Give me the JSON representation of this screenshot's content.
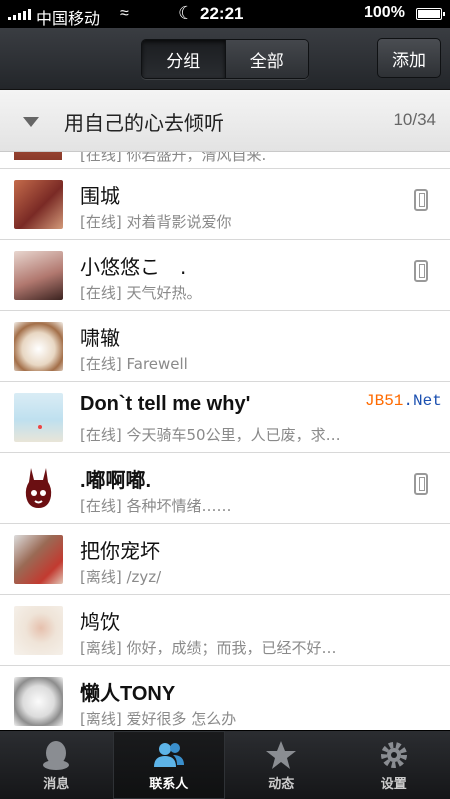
{
  "status_bar": {
    "carrier": "中国移动",
    "time": "22:21",
    "battery": "100%"
  },
  "nav": {
    "segments": [
      "分组",
      "全部"
    ],
    "add_label": "添加"
  },
  "group": {
    "name": "用自己的心去倾听",
    "count": "10/34"
  },
  "partial_row": {
    "sub": "[在线] 你若盛开，清风自来."
  },
  "contacts": [
    {
      "name": "围城",
      "status": "[在线]",
      "message": "对着背影说爱你",
      "phone": true
    },
    {
      "name": "小悠悠こ　.",
      "status": "[在线]",
      "message": "天气好热。",
      "phone": true
    },
    {
      "name": "啸辙",
      "status": "[在线]",
      "message": "Farewell",
      "phone": false
    },
    {
      "name": "Don`t tell me why'",
      "status": "[在线]",
      "message": "今天骑车50公里，人已废，求…",
      "phone": false
    },
    {
      "name": ".嘟啊嘟.",
      "status": "[在线]",
      "message": "各种坏情绪……",
      "phone": true
    },
    {
      "name": "把你宠坏",
      "status": "[离线]",
      "message": "/zyz/",
      "phone": false
    },
    {
      "name": "鸠饮",
      "status": "[离线]",
      "message": "你好，成绩；而我，已经不好…",
      "phone": false
    },
    {
      "name": "懒人TONY",
      "status": "[离线]",
      "message": "爱好很多 怎么办",
      "phone": false
    }
  ],
  "watermark": {
    "jb": "JB51",
    "net": ".Net"
  },
  "tabs": [
    {
      "label": "消息",
      "icon": "penguin-icon"
    },
    {
      "label": "联系人",
      "icon": "contacts-icon"
    },
    {
      "label": "动态",
      "icon": "star-icon"
    },
    {
      "label": "设置",
      "icon": "gear-icon"
    }
  ]
}
